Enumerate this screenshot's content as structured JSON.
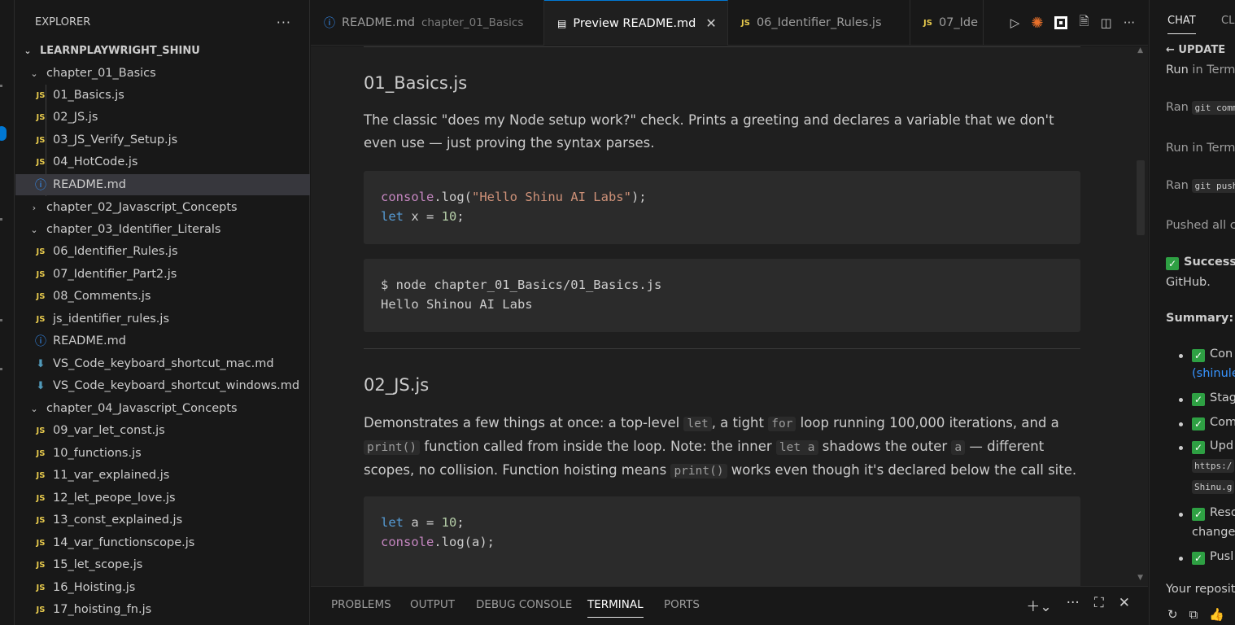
{
  "sidebar": {
    "title": "EXPLORER",
    "more": "···",
    "root": "LEARNPLAYWRIGHT_SHINU",
    "ch1": "chapter_01_Basics",
    "ch1_files": [
      "01_Basics.js",
      "02_JS.js",
      "03_JS_Verify_Setup.js",
      "04_HotCode.js",
      "README.md"
    ],
    "ch2": "chapter_02_Javascript_Concepts",
    "ch3": "chapter_03_Identifier_Literals",
    "ch3_files": [
      "06_Identifier_Rules.js",
      "07_Identifier_Part2.js",
      "08_Comments.js",
      "js_identifier_rules.js",
      "README.md",
      "VS_Code_keyboard_shortcut_mac.md",
      "VS_Code_keyboard_shortcut_windows.md"
    ],
    "ch4": "chapter_04_Javascript_Concepts",
    "ch4_files": [
      "09_var_let_const.js",
      "10_functions.js",
      "11_var_explained.js",
      "12_let_peope_love.js",
      "13_const_explained.js",
      "14_var_functionscope.js",
      "15_let_scope.js",
      "16_Hoisting.js",
      "17_hoisting_fn.js"
    ],
    "js_badge": "JS"
  },
  "tabs": {
    "t1": "README.md",
    "t1_desc": "chapter_01_Basics",
    "t2": "Preview README.md",
    "t3": "06_Identifier_Rules.js",
    "t4": "07_Ide",
    "js_badge": "JS",
    "close": "✕"
  },
  "preview": {
    "h1": "01_Basics.js",
    "p1": "The classic \"does my Node setup work?\" check. Prints a greeting and declares a variable that we don't even use — just proving the syntax parses.",
    "code1_fn": "console",
    "code1_rest": ".log(",
    "code1_str": "\"Hello Shinu AI Labs\"",
    "code1_end": ");",
    "code1_let": "let",
    "code1_x": " x = ",
    "code1_num": "10",
    "code1_semi": ";",
    "code2_cmd": "$ node chapter_01_Basics/01_Basics.js",
    "code2_out": "Hello Shinou AI Labs",
    "h2": "02_JS.js",
    "p2_a": "Demonstrates a few things at once: a top-level ",
    "p2_let": "let",
    "p2_b": ", a tight ",
    "p2_for": "for",
    "p2_c": " loop running 100,000 iterations, and a ",
    "p2_print": "print()",
    "p2_d": " function called from inside the loop. Note: the inner ",
    "p2_leta": "let a",
    "p2_e": " shadows the outer ",
    "p2_a2": "a",
    "p2_f": " — different scopes, no collision. Function hoisting means ",
    "p2_print2": "print()",
    "p2_g": " works even though it's declared below the call site.",
    "code3_let": "let",
    "code3_a": " a = ",
    "code3_num": "10",
    "code3_semi": ";",
    "code3_fn": "console",
    "code3_rest": ".log(a);"
  },
  "panel": {
    "problems": "PROBLEMS",
    "output": "OUTPUT",
    "debug": "DEBUG CONSOLE",
    "terminal": "TERMINAL",
    "ports": "PORTS"
  },
  "chat": {
    "tab_chat": "CHAT",
    "tab_cl": "CL",
    "update": "UPDATE",
    "run1_a": "Run",
    "run1_b": " in Termi",
    "ran1": "Ran",
    "ran1_code": "git comm",
    "run2_a": "Run",
    "run2_b": " in Termi",
    "ran2": "Ran",
    "ran2_code": "git push",
    "pushed": "Pushed all co",
    "success": "Success",
    "github": "GitHub.",
    "summary": "Summary:",
    "b1": "Con",
    "b1_link": "(shinule",
    "b2": "Stag",
    "b3": "Com",
    "b4": "Upd",
    "b4_code": "https:/",
    "b4_code2": "Shinu.g",
    "b5": "Reso",
    "b5_2": "changes",
    "b6": "Pusl",
    "your": "Your reposit"
  }
}
